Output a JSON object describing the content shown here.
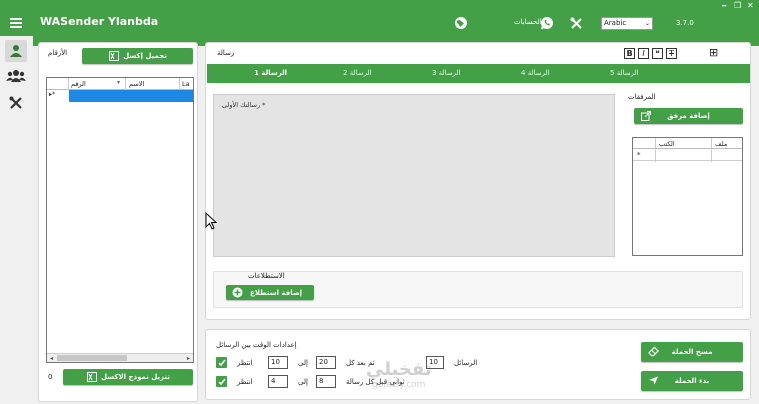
{
  "app": {
    "title": "WASender Ylanbda",
    "version": "3.7.0",
    "language": "Arabic",
    "accounts_label": "الحسابات",
    "accent": "#43a047"
  },
  "window_controls": {
    "minimize": "━",
    "maximize": "❐",
    "close": "✕"
  },
  "numbers_panel": {
    "title": "الأرقام",
    "load_excel": "تحميل إكسل",
    "download_template": "تنزيل نموذج الاكسل",
    "count": "0",
    "columns": [
      "الرقم",
      "الاسم",
      "La"
    ],
    "row_marker": "▸*"
  },
  "message_panel": {
    "title": "رسالة",
    "format_buttons": [
      "B",
      "I",
      "❝",
      "T"
    ],
    "add_icon": "⊞",
    "tabs": [
      "الرسالة 1",
      "الرسالة 2",
      "الرسالة 3",
      "الرسالة 4",
      "الرسالة 5"
    ],
    "textarea_placeholder": "رسالتك الأولى *",
    "attachments_title": "المرفقات",
    "add_attachment": "إضافة مرفق",
    "attachments_columns": [
      "ملف",
      "الكتب"
    ],
    "attachments_row_marker": "*",
    "polls_title": "الاستطلاعات",
    "add_poll": "إضافة استطلاع"
  },
  "time_settings": {
    "title": "إعدادات الوقت بين الرسائل",
    "row1": {
      "label": "الرسائل",
      "messages": "10",
      "after_label": "ثم بعد كل",
      "from": "20",
      "to_label": "إلى",
      "to": "10",
      "wait_label": "انتظر"
    },
    "row2": {
      "label": "ثواني قبل كل رسالة",
      "from": "8",
      "to_label": "إلى",
      "to": "4",
      "wait_label": "انتظر"
    }
  },
  "campaign": {
    "clear": "مسح الحملة",
    "start": "بدء الحملة"
  },
  "watermark": {
    "main": "تفخيلي",
    "sub": "gofezly.com"
  }
}
